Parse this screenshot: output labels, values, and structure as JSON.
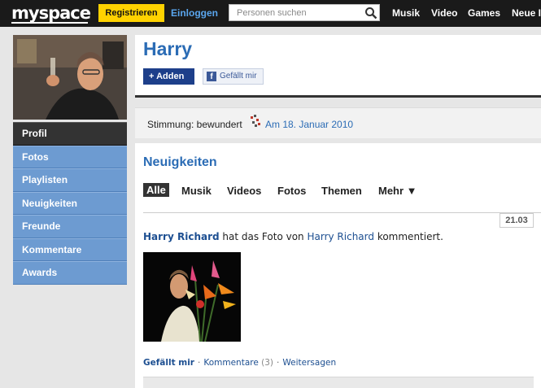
{
  "topbar": {
    "logo": "myspace",
    "register_label": "Registrieren",
    "login_label": "Einloggen",
    "search_placeholder": "Personen suchen",
    "nav": [
      "Musik",
      "Video",
      "Games",
      "Neue I"
    ]
  },
  "profile": {
    "name": "Harry",
    "add_label": "Adden",
    "like_label": "Gefällt mir"
  },
  "sidebar": {
    "items": [
      {
        "label": "Profil",
        "active": true
      },
      {
        "label": "Fotos"
      },
      {
        "label": "Playlisten"
      },
      {
        "label": "Neuigkeiten"
      },
      {
        "label": "Freunde"
      },
      {
        "label": "Kommentare"
      },
      {
        "label": "Awards"
      }
    ]
  },
  "mood": {
    "label": "Stimmung: bewundert",
    "date": "Am 18. Januar 2010"
  },
  "feed": {
    "title": "Neuigkeiten",
    "tabs": [
      "Alle",
      "Musik",
      "Videos",
      "Fotos",
      "Themen",
      "Mehr ▼"
    ],
    "post": {
      "date_badge": "21.03",
      "actor": "Harry Richard",
      "verb": " hat das Foto von ",
      "target": "Harry Richard",
      "tail": " kommentiert.",
      "actions": {
        "like": "Gefällt mir",
        "comments": "Kommentare",
        "comments_count": "(3)",
        "share": "Weitersagen"
      }
    }
  },
  "colors": {
    "accent_blue": "#2b6cb5",
    "sidebar_blue": "#6d9bd1",
    "register_yellow": "#ffd200",
    "topbar_black": "#1a1a1a"
  }
}
